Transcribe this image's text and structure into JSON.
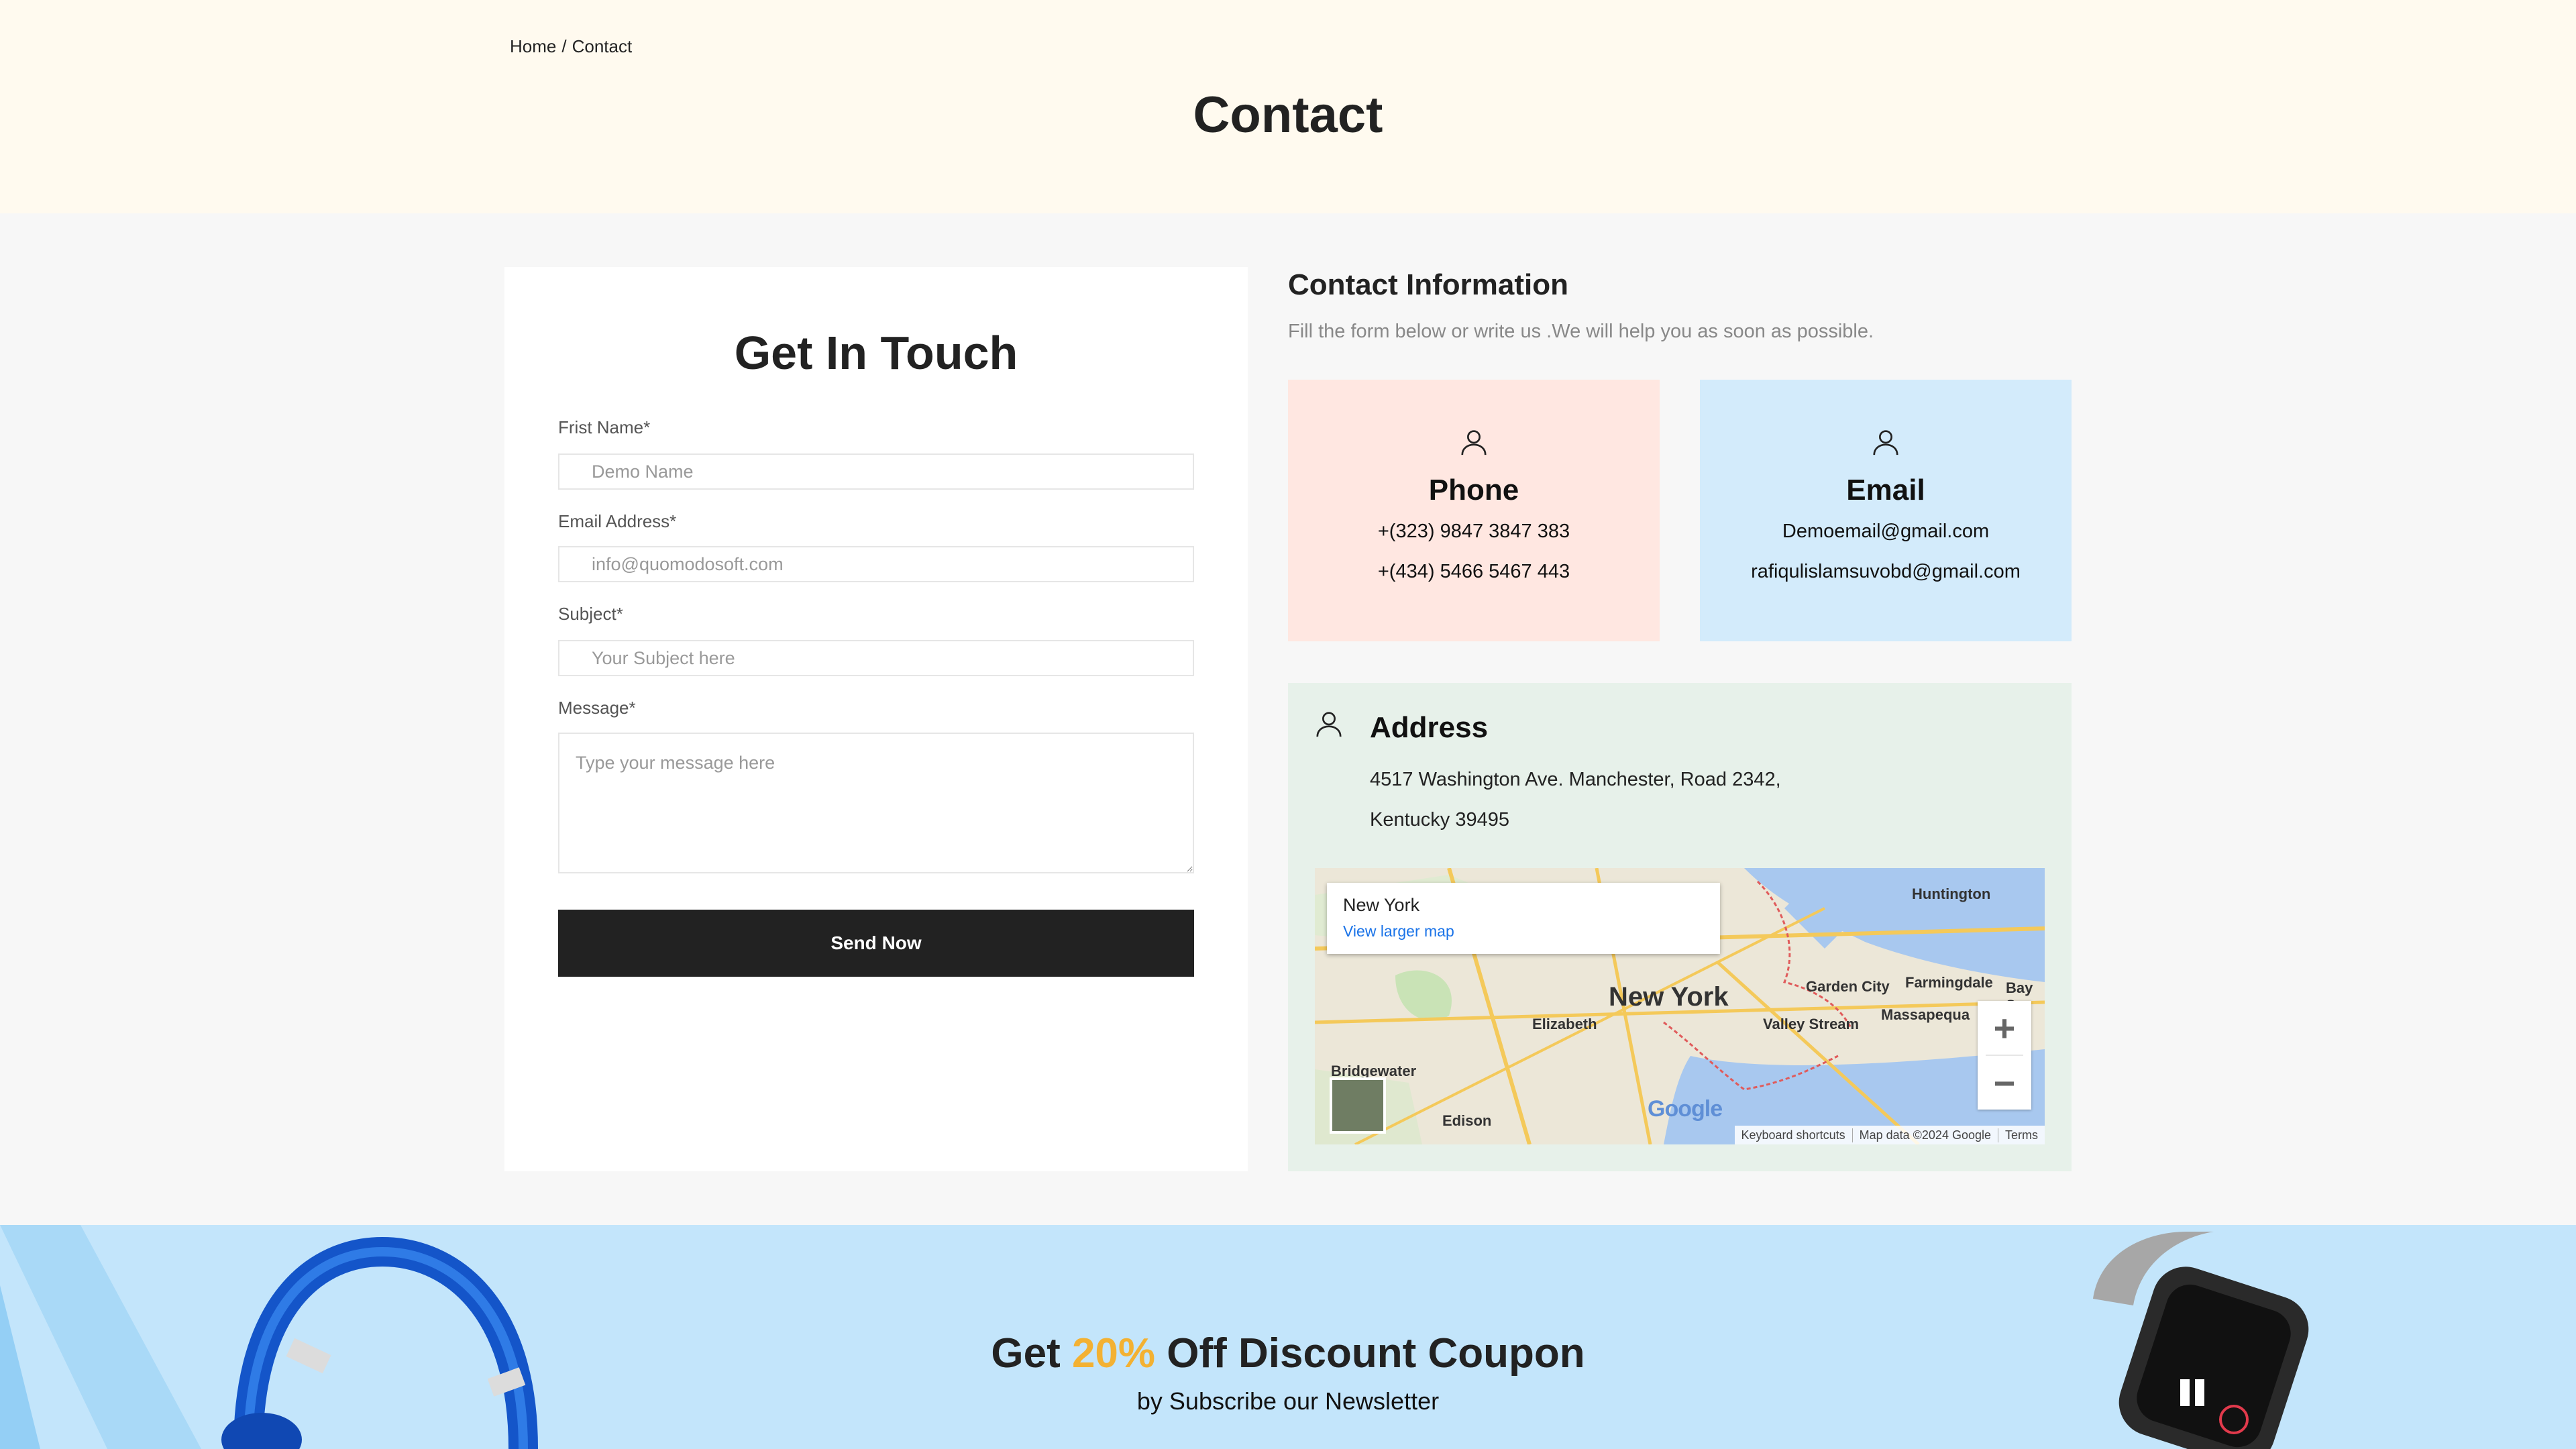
{
  "breadcrumb": {
    "home": "Home",
    "separator": "/",
    "current": "Contact"
  },
  "page": {
    "title": "Contact"
  },
  "form": {
    "title": "Get In Touch",
    "first_name_label": "Frist Name*",
    "first_name_placeholder": "Demo Name",
    "email_label": "Email Address*",
    "email_placeholder": "info@quomodosoft.com",
    "subject_label": "Subject*",
    "subject_placeholder": "Your Subject here",
    "message_label": "Message*",
    "message_placeholder": "Type your message here",
    "submit_label": "Send Now"
  },
  "contact_info": {
    "title": "Contact Information",
    "subtitle": "Fill the form below or write us .We will help you as soon as possible.",
    "phone": {
      "title": "Phone",
      "lines": [
        "+(323) 9847 3847 383",
        "+(434) 5466 5467 443"
      ],
      "icon": "user-icon",
      "bg": "#ffe7e1"
    },
    "email": {
      "title": "Email",
      "lines": [
        "Demoemail@gmail.com",
        "rafiqulislamsuvobd@gmail.com"
      ],
      "icon": "user-icon",
      "bg": "#d3ebfb"
    },
    "address": {
      "title": "Address",
      "lines": [
        "4517 Washington Ave. Manchester, Road 2342,",
        "Kentucky 39495"
      ],
      "icon": "user-icon",
      "bg": "#e7f1ea"
    }
  },
  "map": {
    "popup_place": "New York",
    "popup_link": "View larger map",
    "zoom_in": "+",
    "zoom_out": "−",
    "footer": [
      "Keyboard shortcuts",
      "Map data ©2024 Google",
      "Terms"
    ],
    "brand": "Google",
    "labels": [
      "New York",
      "Huntington",
      "Garden City",
      "Farmingdale",
      "Bay S",
      "Elizabeth",
      "Valley Stream",
      "Massapequa",
      "Bridgewater",
      "Edison"
    ]
  },
  "newsletter": {
    "title_pre": "Get",
    "title_pct": "20%",
    "title_post": "Off Discount Coupon",
    "subtitle": "by Subscribe our Newsletter",
    "accent": "#f3b132"
  }
}
